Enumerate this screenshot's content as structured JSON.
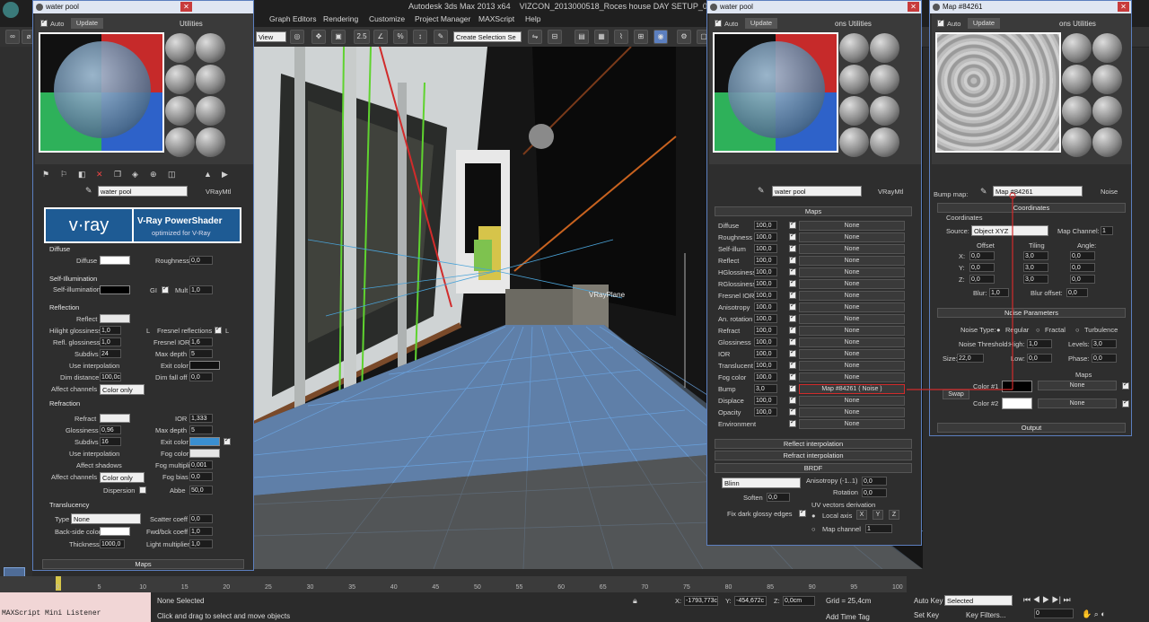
{
  "app": {
    "title": "Autodesk 3ds Max  2013 x64",
    "file": "VIZCON_2013000518_Roces house DAY SETUP_01.max",
    "menu": [
      "Graph Editors",
      "Rendering",
      "Customize",
      "Project Manager",
      "MAXScript",
      "Help"
    ],
    "toolbar": {
      "view_dropdown": "View",
      "selection_set": "Create Selection Se",
      "snap_label": "2.5"
    }
  },
  "side_tabs": {
    "left": "Utilities",
    "mid": "ons  Utilities",
    "right": "ons  Utilities"
  },
  "mat_editor_left": {
    "window_title": "water pool",
    "auto_label": "Auto",
    "update_label": "Update",
    "material_name": "water pool",
    "material_type": "VRayMtl",
    "logo": "v·ray",
    "banner_title": "V-Ray PowerShader",
    "banner_sub": "optimized for V-Ray",
    "diffuse": {
      "section": "Diffuse",
      "diffuse_label": "Diffuse",
      "roughness_label": "Roughness",
      "roughness": "0,0"
    },
    "selfillum": {
      "section": "Self-Illumination",
      "label": "Self-illumination",
      "gi_label": "GI",
      "mult_label": "Mult",
      "mult": "1,0"
    },
    "reflection": {
      "section": "Reflection",
      "reflect": "Reflect",
      "hilight": "Hilight glossiness",
      "hilight_val": "1,0",
      "L": "L",
      "fresnel": "Fresnel reflections",
      "refl_gloss": "Refl. glossiness",
      "refl_gloss_val": "1,0",
      "fresnel_ior": "Fresnel IOR",
      "fresnel_ior_val": "1,6",
      "subdivs": "Subdivs",
      "subdivs_val": "24",
      "max_depth": "Max depth",
      "max_depth_val": "5",
      "use_interp": "Use interpolation",
      "exit_color": "Exit color",
      "dim_distance": "Dim distance",
      "dim_val": "100,0c",
      "dim_falloff": "Dim fall off",
      "dim_falloff_val": "0,0",
      "affect": "Affect channels",
      "affect_val": "Color only"
    },
    "refraction": {
      "section": "Refraction",
      "refract": "Refract",
      "ior": "IOR",
      "ior_val": "1,333",
      "glossiness": "Glossiness",
      "gloss_val": "0,96",
      "max_depth": "Max depth",
      "max_depth_val": "5",
      "subdivs": "Subdivs",
      "subdivs_val": "16",
      "exit_color": "Exit color",
      "use_interp": "Use interpolation",
      "fog_color": "Fog color",
      "affect_shadows": "Affect shadows",
      "fog_mult": "Fog multiplier",
      "fog_mult_val": "0,001",
      "affect": "Affect channels",
      "affect_val": "Color only",
      "fog_bias": "Fog bias",
      "fog_bias_val": "0,0",
      "dispersion": "Dispersion",
      "abbe": "Abbe",
      "abbe_val": "50,0"
    },
    "translucency": {
      "section": "Translucency",
      "type": "Type",
      "type_val": "None",
      "scatter": "Scatter coeff",
      "scatter_val": "0,0",
      "backside": "Back-side color",
      "fwd": "Fwd/bck coeff",
      "fwd_val": "1,0",
      "thickness": "Thickness",
      "thickness_val": "1000,0",
      "light_mult": "Light multiplier",
      "light_mult_val": "1,0"
    },
    "maps_label": "Maps"
  },
  "mat_editor_mid": {
    "window_title": "water pool",
    "auto_label": "Auto",
    "update_label": "Update",
    "material_name": "water pool",
    "material_type": "VRayMtl",
    "maps_header": "Maps",
    "maps": [
      {
        "name": "Diffuse",
        "val": "100,0",
        "map": "None"
      },
      {
        "name": "Roughness",
        "val": "100,0",
        "map": "None"
      },
      {
        "name": "Self-illum",
        "val": "100,0",
        "map": "None"
      },
      {
        "name": "Reflect",
        "val": "100,0",
        "map": "None"
      },
      {
        "name": "HGlossiness",
        "val": "100,0",
        "map": "None"
      },
      {
        "name": "RGlossiness",
        "val": "100,0",
        "map": "None"
      },
      {
        "name": "Fresnel IOR",
        "val": "100,0",
        "map": "None"
      },
      {
        "name": "Anisotropy",
        "val": "100,0",
        "map": "None"
      },
      {
        "name": "An. rotation",
        "val": "100,0",
        "map": "None"
      },
      {
        "name": "Refract",
        "val": "100,0",
        "map": "None"
      },
      {
        "name": "Glossiness",
        "val": "100,0",
        "map": "None"
      },
      {
        "name": "IOR",
        "val": "100,0",
        "map": "None"
      },
      {
        "name": "Translucent",
        "val": "100,0",
        "map": "None"
      },
      {
        "name": "Fog color",
        "val": "100,0",
        "map": "None"
      },
      {
        "name": "Bump",
        "val": "3,0",
        "map": "Map #84261  ( Noise )"
      },
      {
        "name": "Displace",
        "val": "100,0",
        "map": "None"
      },
      {
        "name": "Opacity",
        "val": "100,0",
        "map": "None"
      },
      {
        "name": "Environment",
        "val": "",
        "map": "None"
      }
    ],
    "reflect_interp": "Reflect interpolation",
    "refract_interp": "Refract interpolation",
    "brdf": {
      "section": "BRDF",
      "type": "Blinn",
      "aniso": "Anisotropy (-1..1)",
      "aniso_val": "0,0",
      "rotation": "Rotation",
      "rot_val": "0,0",
      "soften": "Soften",
      "soften_val": "0,0",
      "uv": "UV vectors derivation",
      "local": "Local axis",
      "x": "X",
      "y": "Y",
      "z": "Z",
      "fix": "Fix dark glossy edges",
      "mapch": "Map channel",
      "mapch_val": "1"
    }
  },
  "map_editor": {
    "window_title": "Map #84261",
    "auto_label": "Auto",
    "update_label": "Update",
    "bump_label": "Bump map:",
    "map_name": "Map #84261",
    "map_type": "Noise",
    "coords": {
      "section": "Coordinates",
      "sub": "Coordinates",
      "source": "Source:",
      "source_val": "Object XYZ",
      "mapch": "Map Channel:",
      "mapch_val": "1",
      "offset": "Offset",
      "tiling": "Tiling",
      "angle": "Angle:",
      "x": "X:",
      "y": "Y:",
      "z": "Z:",
      "off_x": "0,0",
      "off_y": "0,0",
      "off_z": "0,0",
      "til_x": "3,0",
      "til_y": "3,0",
      "til_z": "3,0",
      "ang_x": "0,0",
      "ang_y": "0,0",
      "ang_z": "0,0",
      "blur": "Blur:",
      "blur_val": "1,0",
      "blur_off": "Blur offset:",
      "blur_off_val": "0,0"
    },
    "noise": {
      "section": "Noise Parameters",
      "type": "Noise Type:",
      "regular": "Regular",
      "fractal": "Fractal",
      "turbulence": "Turbulence",
      "thresholds": "Noise Threshold:",
      "high": "High:",
      "high_val": "1,0",
      "levels": "Levels:",
      "levels_val": "3,0",
      "size": "Size:",
      "size_val": "22,0",
      "low": "Low:",
      "low_val": "0,0",
      "phase": "Phase:",
      "phase_val": "0,0",
      "maps": "Maps",
      "color1": "Color #1",
      "color2": "Color #2",
      "swap": "Swap",
      "none1": "None",
      "none2": "None"
    },
    "output": "Output"
  },
  "viewport": {
    "label": "VRayPlane"
  },
  "timeline": {
    "ticks": [
      "0",
      "5",
      "10",
      "15",
      "20",
      "25",
      "30",
      "35",
      "40",
      "45",
      "50",
      "55",
      "60",
      "65",
      "70",
      "75",
      "80",
      "85",
      "90",
      "95",
      "100"
    ]
  },
  "status": {
    "listener": "MAXScript Mini Listener",
    "selected": "None Selected",
    "prompt": "Click and drag to select and move objects",
    "x_label": "X:",
    "x_val": "-1793,773c",
    "y_label": "Y:",
    "y_val": "-454,672c",
    "z_label": "Z:",
    "z_val": "0,0cm",
    "grid": "Grid = 25,4cm",
    "add_time_tag": "Add Time Tag",
    "autokey": "Auto Key",
    "autokey_val": "Selected",
    "setkey": "Set Key",
    "keyfilters": "Key Filters...",
    "frame": "0"
  },
  "colors": {
    "accent_blue": "#5c7fbf",
    "link_red": "#d12b2b",
    "exit_color_blue": "#3a8fd1"
  }
}
